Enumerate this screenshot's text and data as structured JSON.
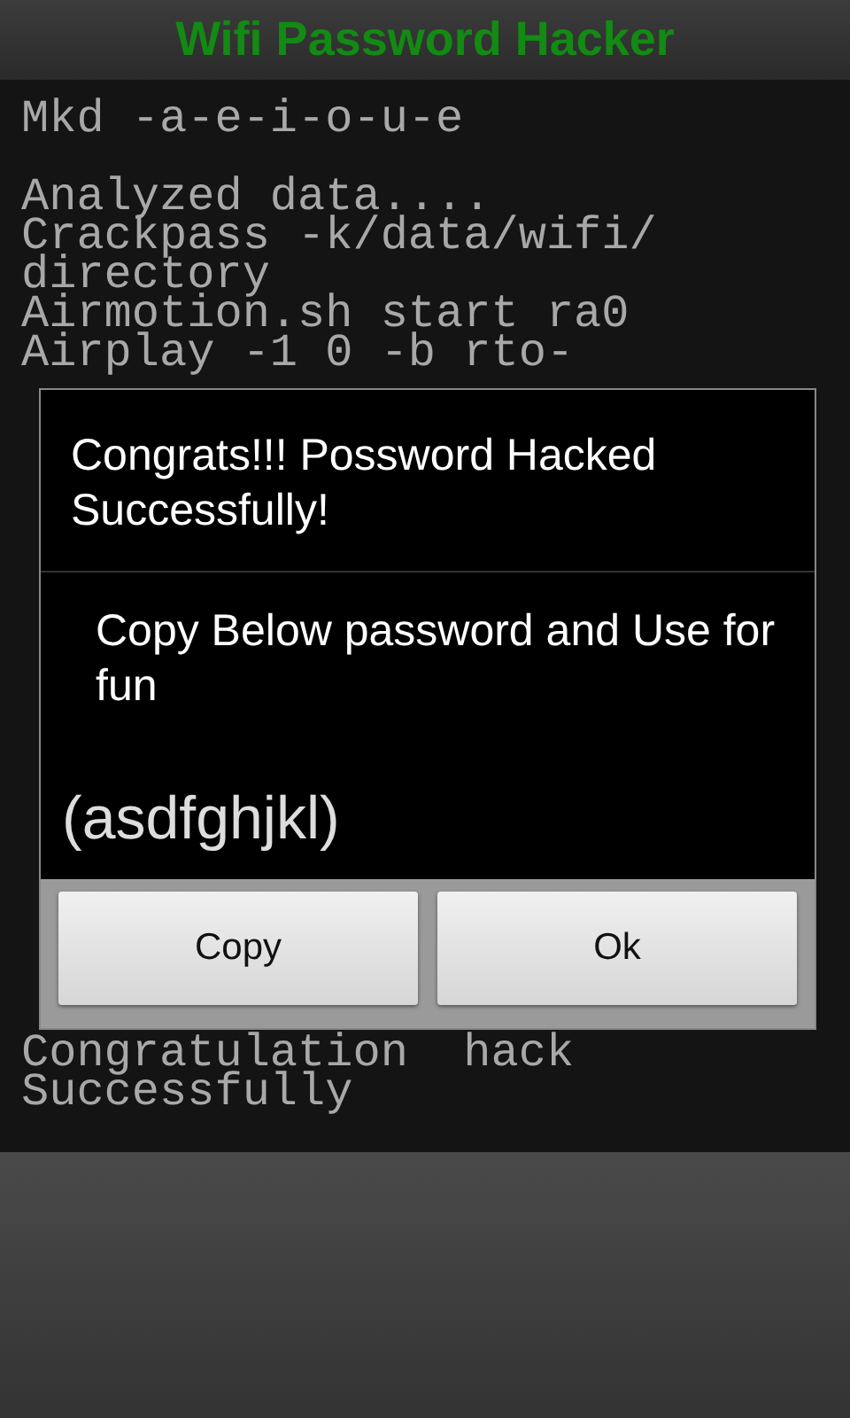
{
  "header": {
    "title": "Wifi Password Hacker"
  },
  "terminal": {
    "blocks": [
      [
        "Mkd -a-e-i-o-u-e"
      ],
      [
        "Analyzed data....",
        "Crackpass -k/data/wifi/",
        "directory",
        "Airmotion.sh start ra0",
        "Airplay -1 0 -b rto-"
      ],
      [
        "Congratulation  hack",
        "Successfully"
      ]
    ]
  },
  "dialog": {
    "title": "Congrats!!!  Possword Hacked Successfully!",
    "message": "Copy Below password and Use for fun",
    "password": "(asdfghjkl)",
    "buttons": [
      "Copy",
      "Ok"
    ]
  }
}
